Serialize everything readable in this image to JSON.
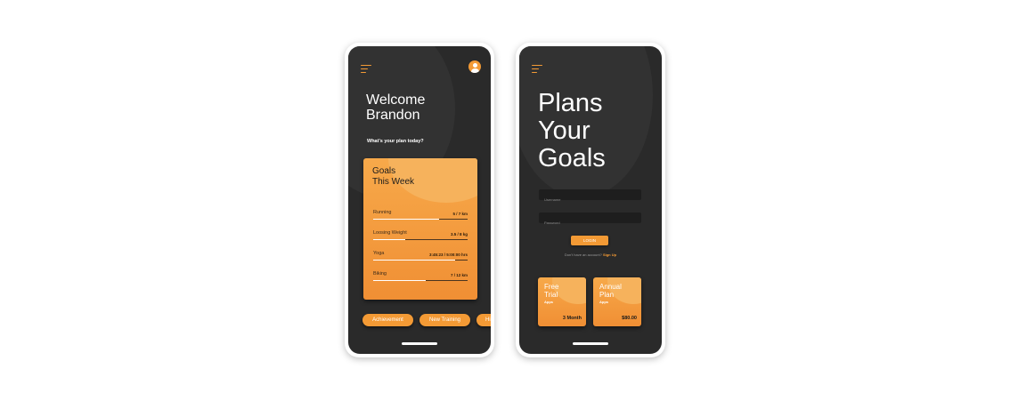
{
  "screen1": {
    "welcome_line1": "Welcome",
    "welcome_line2": "Brandon",
    "subtitle": "What's your plan today?",
    "goals_card": {
      "title_line1": "Goals",
      "title_line2": "This Week",
      "items": [
        {
          "name": "Running",
          "value": "5 / 7 km",
          "progress": 0.7
        },
        {
          "name": "Loosing Weight",
          "value": "3.5 / 8 kg",
          "progress": 0.34
        },
        {
          "name": "Yoga",
          "value": "3:45:23 / 5:00:00 hrs",
          "progress": 0.87
        },
        {
          "name": "Biking",
          "value": "7 / 12 km",
          "progress": 0.56
        }
      ]
    },
    "chips": [
      "Achievement",
      "New Training",
      "Hi"
    ]
  },
  "screen2": {
    "title_line1": "Plans",
    "title_line2": "Your",
    "title_line3": "Goals",
    "username_placeholder": "Username",
    "password_placeholder": "Password",
    "login_label": "LOGIN",
    "signup_prompt": "Don't have an account?",
    "signup_link": "Sign Up",
    "plans": [
      {
        "name_line1": "Free",
        "name_line2": "Trial",
        "apps": "Apps",
        "price": "3 Month"
      },
      {
        "name_line1": "Annual",
        "name_line2": "Plan",
        "apps": "Apps",
        "price": "$80.00"
      }
    ]
  },
  "colors": {
    "accent": "#f39a35",
    "screen_bg": "#2a2a2a",
    "card_light": "#f7a94a"
  },
  "icons": [
    "menu-icon",
    "user-avatar-icon"
  ]
}
